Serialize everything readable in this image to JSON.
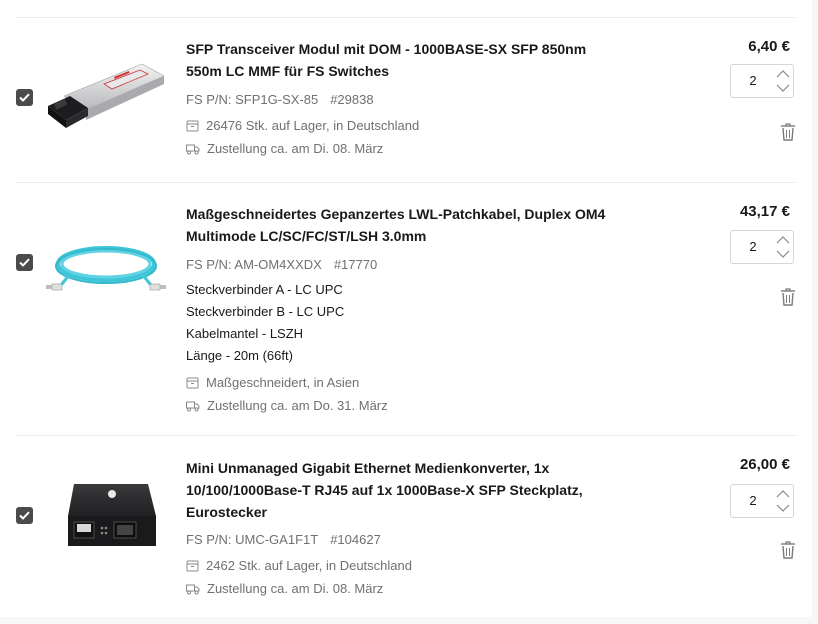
{
  "items": [
    {
      "title": "SFP Transceiver Modul mit DOM - 1000BASE-SX SFP 850nm 550m LC MMF für FS Switches",
      "pn": "FS P/N: SFP1G-SX-85",
      "id": "#29838",
      "specs": [],
      "stock": "26476 Stk. auf Lager, in Deutschland",
      "delivery": "Zustellung ca. am Di. 08. März",
      "price": "6,40 €",
      "qty": "2",
      "checked": true
    },
    {
      "title": "Maßgeschneidertes Gepanzertes LWL-Patchkabel, Duplex OM4 Multimode LC/SC/FC/ST/LSH 3.0mm",
      "pn": "FS P/N: AM-OM4XXDX",
      "id": "#17770",
      "specs": [
        "Steckverbinder A - LC UPC",
        "Steckverbinder B - LC UPC",
        "Kabelmantel - LSZH",
        "Länge - 20m (66ft)"
      ],
      "stock": "Maßgeschneidert, in Asien",
      "delivery": "Zustellung ca. am Do. 31. März",
      "price": "43,17 €",
      "qty": "2",
      "checked": true
    },
    {
      "title": "Mini Unmanaged Gigabit Ethernet Medienkonverter, 1x 10/100/1000Base-T RJ45 auf 1x 1000Base-X SFP Steckplatz, Eurostecker",
      "pn": "FS P/N: UMC-GA1F1T",
      "id": "#104627",
      "specs": [],
      "stock": "2462 Stk. auf Lager, in Deutschland",
      "delivery": "Zustellung ca. am Di. 08. März",
      "price": "26,00 €",
      "qty": "2",
      "checked": true
    }
  ],
  "colors": {
    "checkbox": "#4b4b4d",
    "muted": "#707070",
    "border": "#d6d6d6"
  },
  "icons": [
    "checkmark-icon",
    "warehouse-icon",
    "truck-icon",
    "chevron-up-icon",
    "chevron-down-icon",
    "trash-icon"
  ]
}
